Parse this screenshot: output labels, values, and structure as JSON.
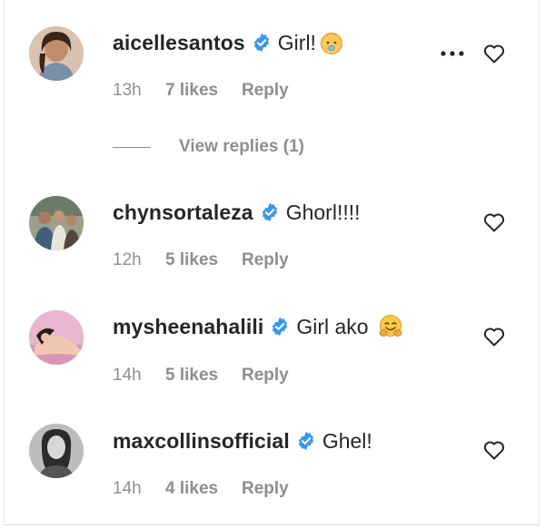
{
  "colors": {
    "verified": "#3897f0",
    "secondary_text": "#8e8e8e",
    "primary_text": "#262626"
  },
  "comments": [
    {
      "username": "aicellesantos",
      "verified": true,
      "text": "Girl!",
      "emoji": "baby-emoji",
      "time": "13h",
      "likes": "7 likes",
      "reply": "Reply",
      "avatar_icon": "avatar-photo"
    },
    {
      "username": "chynsortaleza",
      "verified": true,
      "text": "Ghorl!!!!",
      "time": "12h",
      "likes": "5 likes",
      "reply": "Reply",
      "avatar_icon": "avatar-photo"
    },
    {
      "username": "mysheenahalili",
      "verified": true,
      "text": "Girl ako",
      "emoji": "hugging-face-emoji",
      "time": "14h",
      "likes": "5 likes",
      "reply": "Reply",
      "avatar_icon": "avatar-photo"
    },
    {
      "username": "maxcollinsofficial",
      "verified": true,
      "text": "Ghel!",
      "time": "14h",
      "likes": "4 likes",
      "reply": "Reply",
      "avatar_icon": "avatar-photo"
    }
  ],
  "view_replies": "View replies (1)",
  "more_options_icon": "more-options-icon",
  "heart_icon": "heart-outline-icon"
}
